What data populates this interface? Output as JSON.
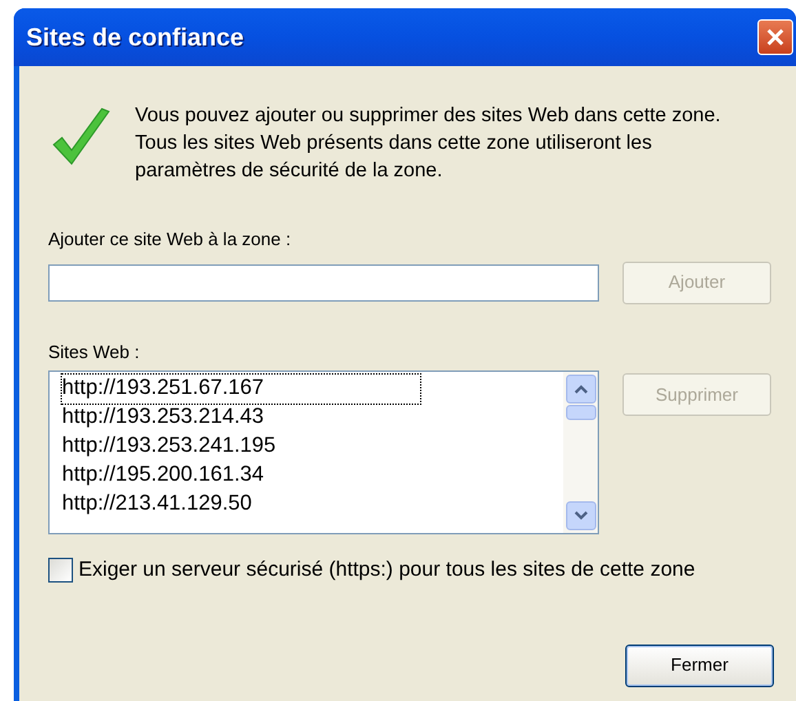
{
  "window": {
    "title": "Sites de confiance"
  },
  "description": "Vous pouvez ajouter ou supprimer des sites Web dans cette zone. Tous les sites Web présents dans cette zone utiliseront les paramètres de sécurité de la zone.",
  "add_field": {
    "label": "Ajouter ce site Web à la zone :"
  },
  "add_button": {
    "label": "Ajouter",
    "disabled": true
  },
  "sites_label": "Sites Web :",
  "sites": [
    {
      "url": "http://193.251.67.167",
      "selected": true
    },
    {
      "url": "http://193.253.214.43",
      "selected": false
    },
    {
      "url": "http://193.253.241.195",
      "selected": false
    },
    {
      "url": "http://195.200.161.34",
      "selected": false
    },
    {
      "url": "http://213.41.129.50",
      "selected": false
    }
  ],
  "remove_button": {
    "label": "Supprimer",
    "disabled": true
  },
  "https_checkbox": {
    "label": "Exiger un serveur sécurisé (https:) pour tous les sites de cette zone",
    "checked": false
  },
  "close_button": {
    "label": "Fermer",
    "disabled": false
  }
}
